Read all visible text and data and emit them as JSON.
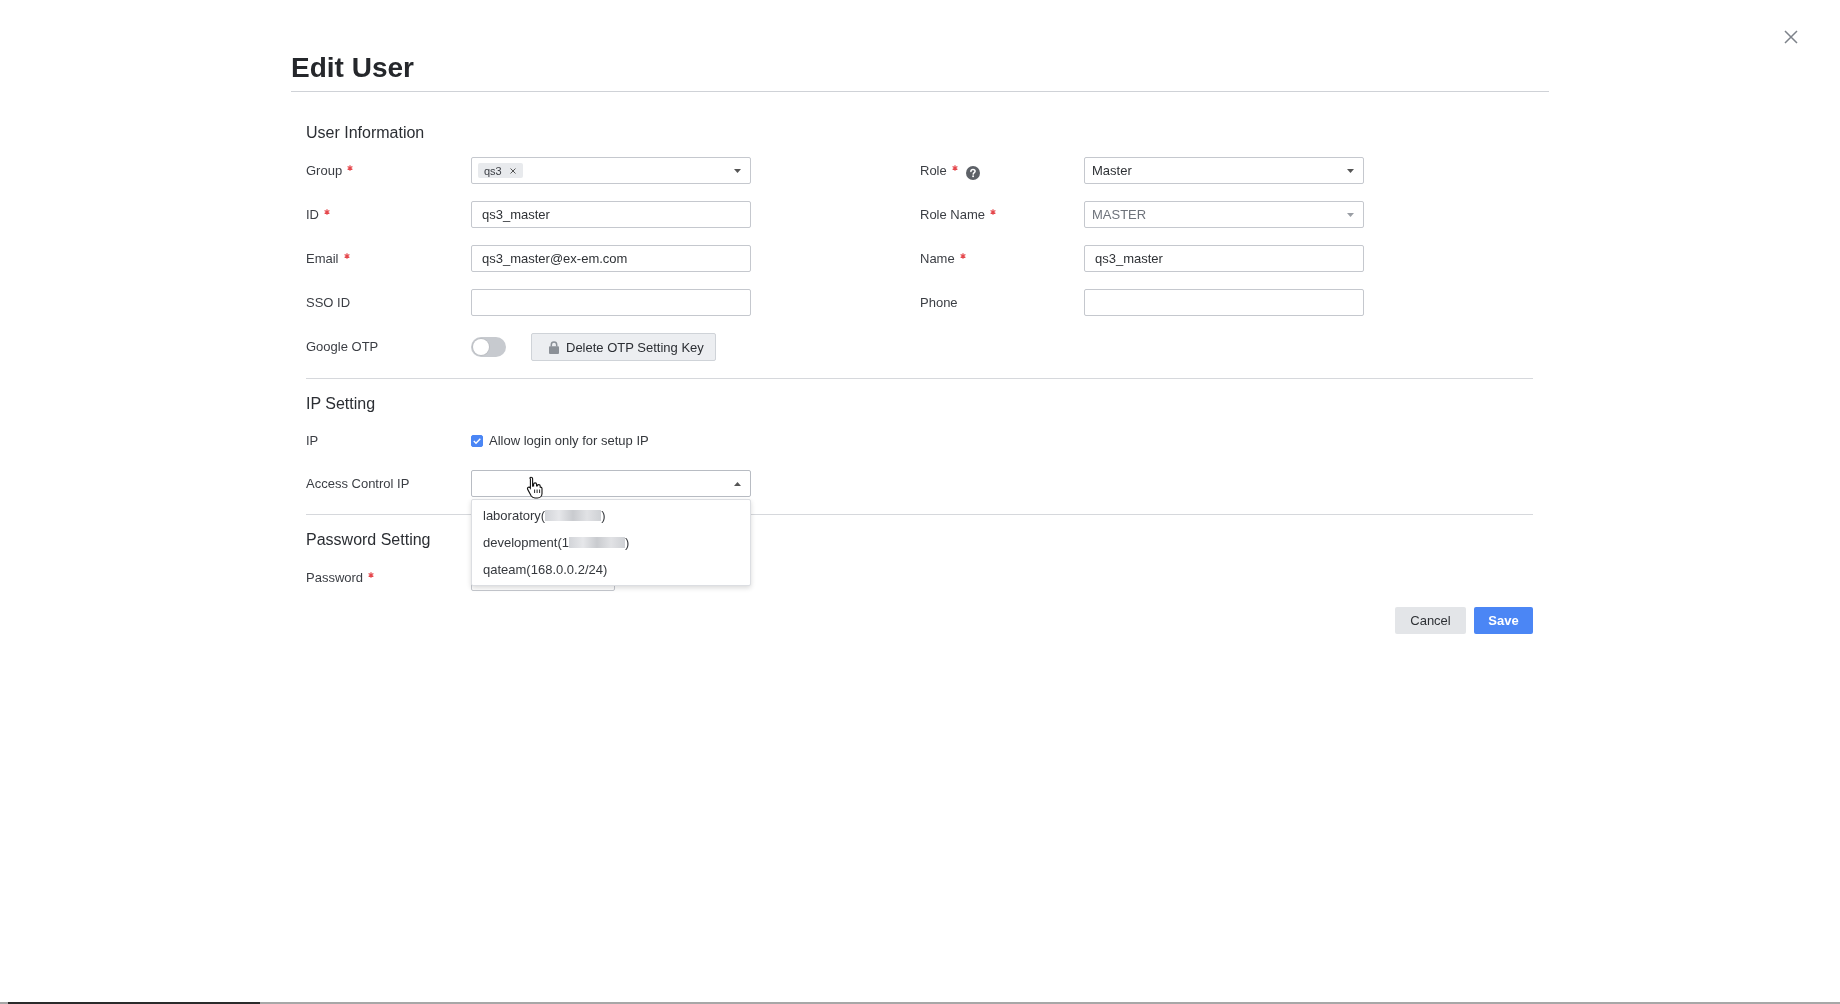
{
  "title": "Edit User",
  "sections": [
    {
      "title": "User Information",
      "rows": [
        [
          {
            "label": "Group",
            "required": true,
            "help": false,
            "kind": "multiselect",
            "disabled": false,
            "expanded": false,
            "tags": [
              "qs3"
            ]
          },
          {
            "label": "Role",
            "required": true,
            "help": true,
            "kind": "select",
            "disabled": false,
            "expanded": false,
            "value": "Master"
          }
        ],
        [
          {
            "label": "ID",
            "required": true,
            "help": false,
            "kind": "text",
            "disabled": false,
            "value": "qs3_master"
          },
          {
            "label": "Role Name",
            "required": true,
            "help": false,
            "kind": "select",
            "disabled": true,
            "expanded": false,
            "value": "MASTER"
          }
        ],
        [
          {
            "label": "Email",
            "required": true,
            "help": false,
            "kind": "text",
            "disabled": false,
            "value": "qs3_master@ex-em.com"
          },
          {
            "label": "Name",
            "required": true,
            "help": false,
            "kind": "text",
            "disabled": false,
            "value": "qs3_master"
          }
        ],
        [
          {
            "label": "SSO ID",
            "required": false,
            "help": false,
            "kind": "text",
            "disabled": false
          },
          {
            "label": "Phone",
            "required": false,
            "help": false,
            "kind": "text",
            "disabled": false
          }
        ],
        [
          {
            "label": "Google OTP",
            "required": false,
            "help": false,
            "kind": "toggle",
            "on": false,
            "action": "Delete OTP Setting Key"
          }
        ]
      ]
    },
    {
      "title": "IP Setting",
      "rows": [
        [
          {
            "label": "IP",
            "required": false,
            "help": false,
            "kind": "checkbox",
            "checked": true,
            "text": "Allow login only for setup IP"
          }
        ],
        [
          {
            "label": "Access Control IP",
            "required": false,
            "help": false,
            "kind": "select",
            "disabled": false,
            "expanded": true,
            "options": [
              {
                "text": "laboratory(",
                "redacted": true,
                "text_after": ")",
                "selected": false
              },
              {
                "text": "development(1",
                "redacted": true,
                "text_after": ")",
                "selected": false
              },
              {
                "text": "qateam(168.0.0.2/24)",
                "redacted": false,
                "selected": false
              }
            ]
          }
        ]
      ]
    },
    {
      "title": "Password Setting",
      "rows": [
        [
          {
            "label": "Password",
            "required": true,
            "help": false,
            "kind": "password"
          }
        ]
      ]
    }
  ],
  "buttons": [
    {
      "label": "Cancel",
      "kind": "secondary"
    },
    {
      "label": "Save",
      "kind": "primary"
    }
  ]
}
